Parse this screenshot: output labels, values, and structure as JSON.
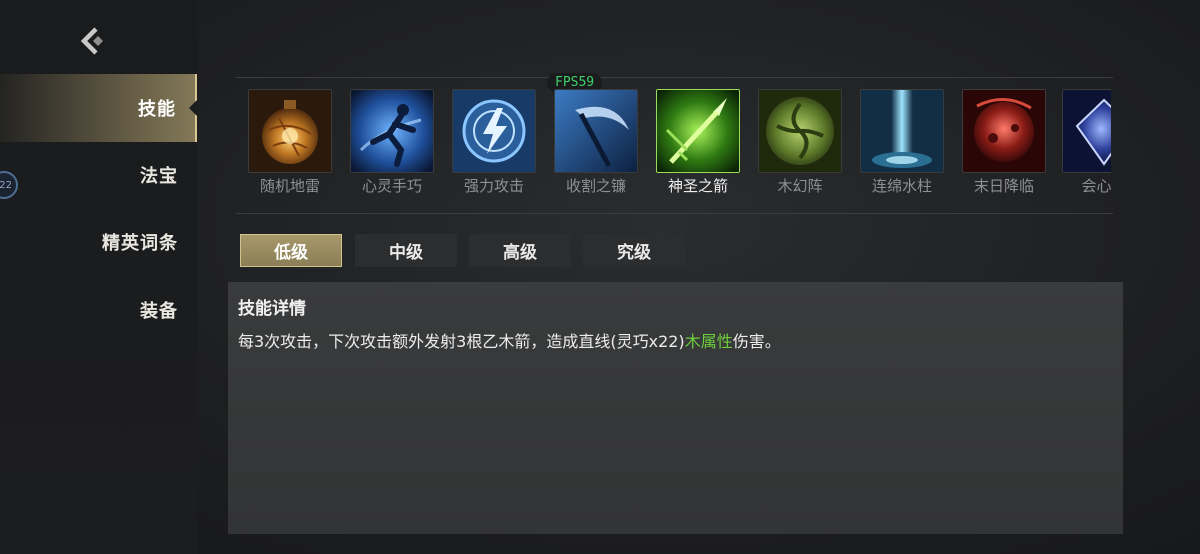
{
  "fps_label": "FPS59",
  "side_badge": "22",
  "sidebar": {
    "items": [
      {
        "label": "技能"
      },
      {
        "label": "法宝"
      },
      {
        "label": "精英词条"
      },
      {
        "label": "装备"
      }
    ]
  },
  "skills": [
    {
      "name": "随机地雷",
      "icon": "golden-mine-icon"
    },
    {
      "name": "心灵手巧",
      "icon": "blue-runner-icon"
    },
    {
      "name": "强力攻击",
      "icon": "lightning-orb-icon"
    },
    {
      "name": "收割之镰",
      "icon": "scythe-icon"
    },
    {
      "name": "神圣之箭",
      "icon": "green-arrow-icon"
    },
    {
      "name": "木幻阵",
      "icon": "wood-formation-icon"
    },
    {
      "name": "连绵水柱",
      "icon": "water-pillar-icon"
    },
    {
      "name": "末日降临",
      "icon": "doom-icon"
    },
    {
      "name": "会心一",
      "icon": "blue-crystal-icon"
    }
  ],
  "tabs": [
    {
      "label": "低级"
    },
    {
      "label": "中级"
    },
    {
      "label": "高级"
    },
    {
      "label": "究级"
    }
  ],
  "detail": {
    "title": "技能详情",
    "desc_before": "每3次攻击，下次攻击额外发射3根乙木箭，造成直线(灵巧x22)",
    "desc_highlight": "木属性",
    "desc_after": "伤害。"
  },
  "colors": {
    "highlight_text": "#6ccf3c",
    "fps_text": "#3fd16b",
    "active_gold": "#b0a070"
  }
}
